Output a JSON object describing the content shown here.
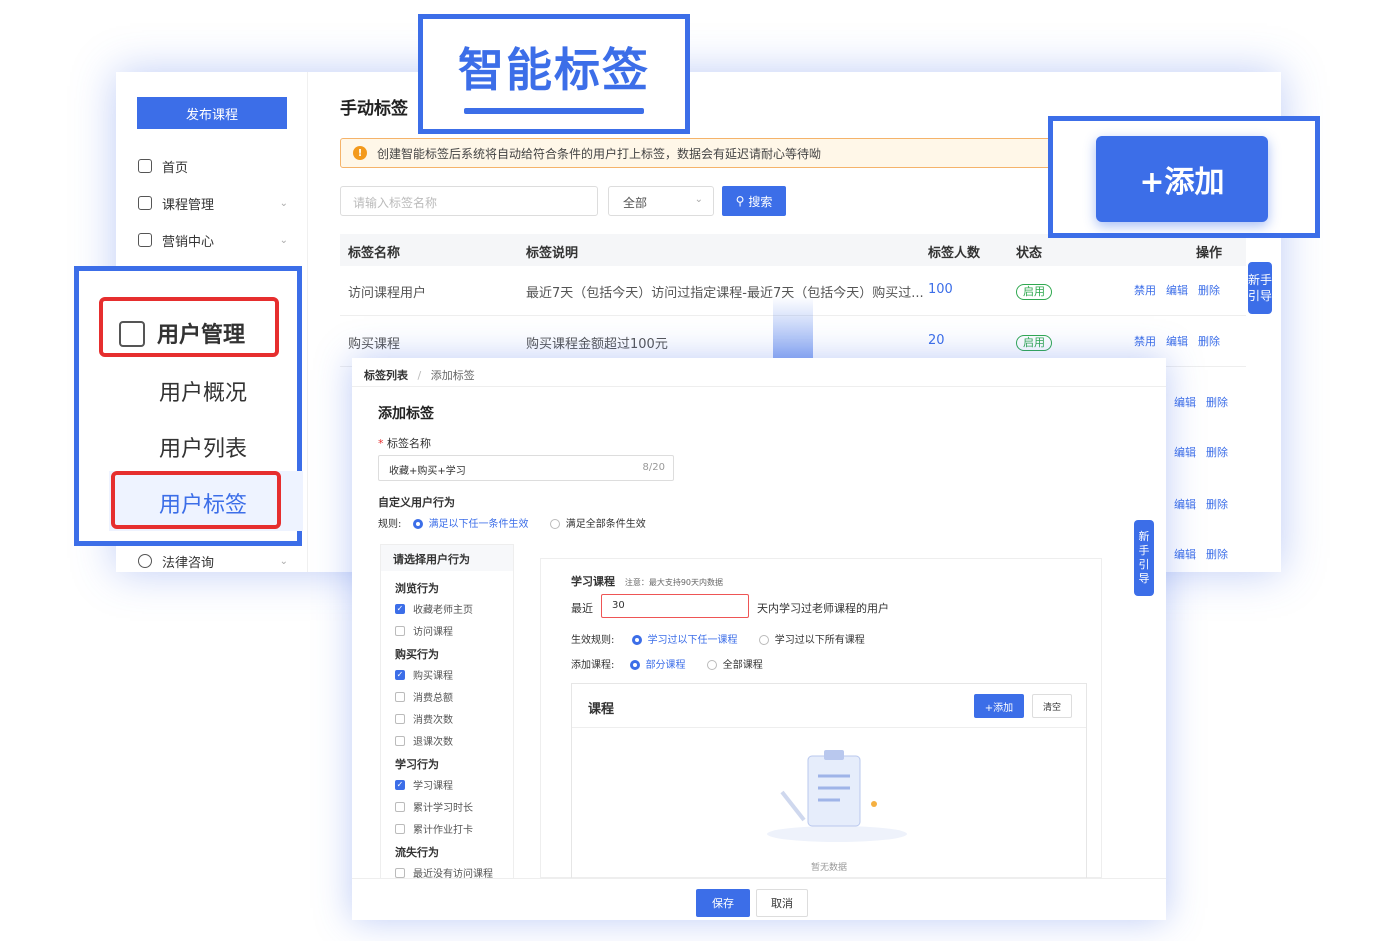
{
  "callouts": {
    "smart_label": "智能标签",
    "add_button": "+添加"
  },
  "back_window": {
    "sidebar": {
      "publish_button": "发布课程",
      "items": [
        {
          "label": "首页",
          "icon": "home-icon"
        },
        {
          "label": "课程管理",
          "icon": "course-icon"
        },
        {
          "label": "营销中心",
          "icon": "marketing-icon"
        },
        {
          "label": "法律咨询",
          "icon": "chat-icon"
        }
      ]
    },
    "title": "手动标签",
    "notice": "创建智能标签后系统将自动给符合条件的用户打上标签，数据会有延迟请耐心等待呦",
    "search": {
      "placeholder": "请输入标签名称",
      "select": "全部",
      "button": "搜索"
    },
    "table": {
      "headers": [
        "标签名称",
        "标签说明",
        "标签人数",
        "状态",
        "操作"
      ],
      "rows": [
        {
          "name": "访问课程用户",
          "desc": "最近7天（包括今天）访问过指定课程-最近7天（包括今天）购买过...",
          "count": "100",
          "status": "启用"
        },
        {
          "name": "购买课程",
          "desc": "购买课程金额超过100元",
          "count": "20",
          "status": "启用"
        }
      ],
      "ops": [
        "禁用",
        "编辑",
        "删除"
      ]
    },
    "guide_tab": "新手引导"
  },
  "user_menu": {
    "title": "用户管理",
    "items": [
      "用户概况",
      "用户列表",
      "用户标签"
    ]
  },
  "front_window": {
    "breadcrumb": [
      "标签列表",
      "添加标签"
    ],
    "title": "添加标签",
    "name_label": "标签名称",
    "name_value": "收藏+购买+学习",
    "name_count": "8/20",
    "behavior_title": "自定义用户行为",
    "rule_label": "规则:",
    "rule_options": [
      "满足以下任一条件生效",
      "满足全部条件生效"
    ],
    "left_panel": {
      "title": "请选择用户行为",
      "groups": [
        {
          "name": "浏览行为",
          "items": [
            {
              "label": "收藏老师主页",
              "checked": true
            },
            {
              "label": "访问课程",
              "checked": false
            }
          ]
        },
        {
          "name": "购买行为",
          "items": [
            {
              "label": "购买课程",
              "checked": true
            },
            {
              "label": "消费总额",
              "checked": false
            },
            {
              "label": "消费次数",
              "checked": false
            },
            {
              "label": "退课次数",
              "checked": false
            }
          ]
        },
        {
          "name": "学习行为",
          "items": [
            {
              "label": "学习课程",
              "checked": true
            },
            {
              "label": "累计学习时长",
              "checked": false
            },
            {
              "label": "累计作业打卡",
              "checked": false
            }
          ]
        },
        {
          "name": "流失行为",
          "items": [
            {
              "label": "最近没有访问课程",
              "checked": false
            }
          ]
        }
      ]
    },
    "study": {
      "title": "学习课程",
      "note": "注意：最大支持90天内数据",
      "recent_label": "最近",
      "recent_value": "30",
      "recent_suffix": "天内学习过老师课程的用户",
      "effect_label": "生效规则:",
      "effect_options": [
        "学习过以下任一课程",
        "学习过以下所有课程"
      ],
      "add_label": "添加课程:",
      "add_options": [
        "部分课程",
        "全部课程"
      ]
    },
    "course": {
      "title": "课程",
      "add": "+添加",
      "clear": "清空",
      "empty": "暂无数据"
    },
    "guide_tab": "新手引导",
    "save": "保存",
    "cancel": "取消"
  }
}
